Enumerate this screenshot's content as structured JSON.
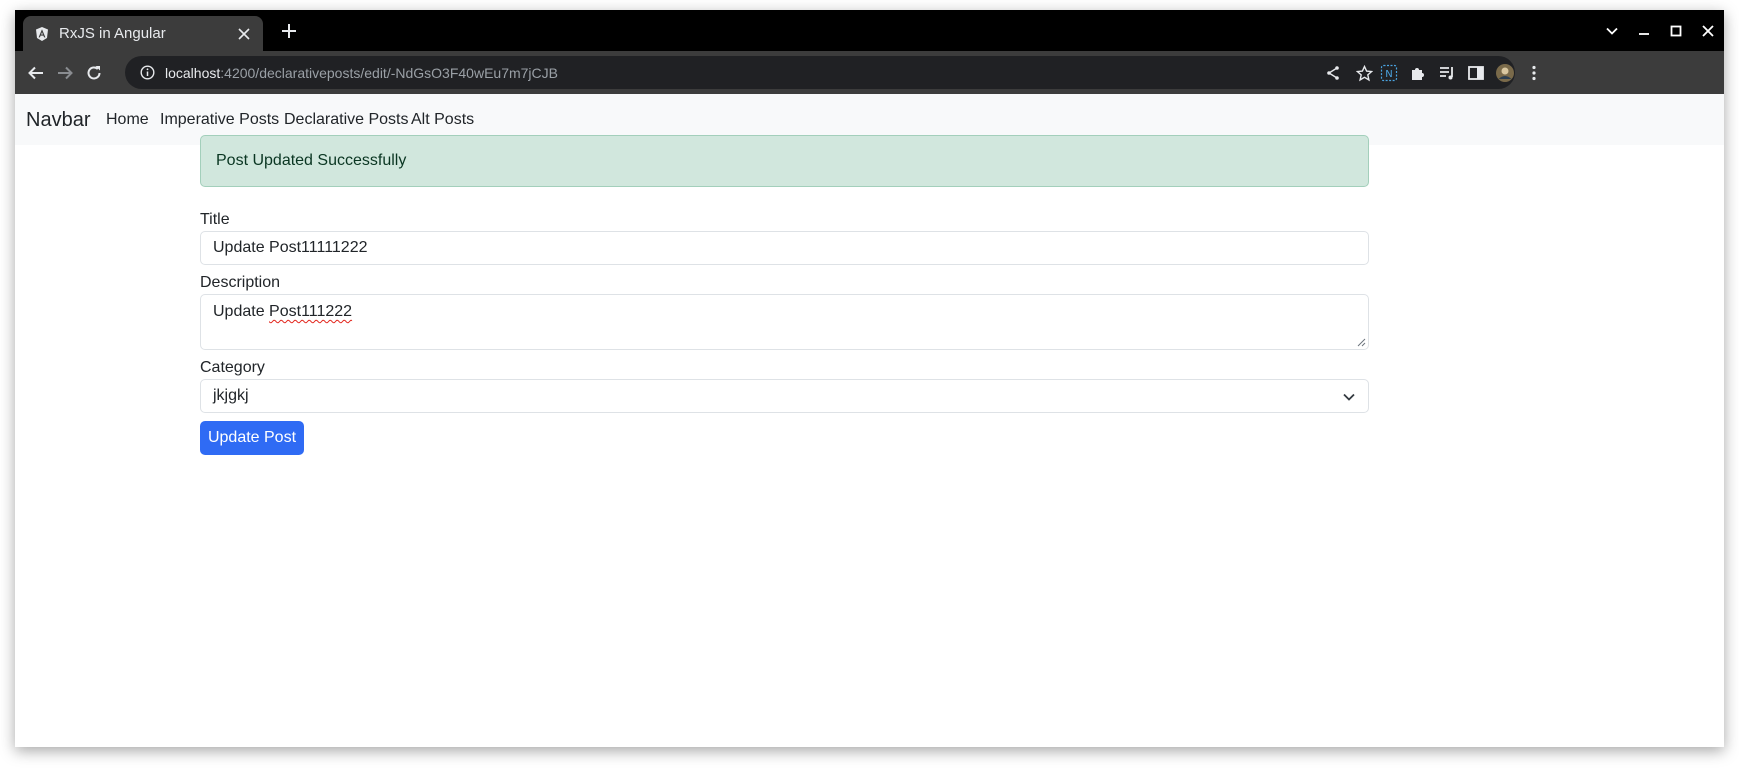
{
  "browser": {
    "tab": {
      "title": "RxJS in Angular",
      "favicon": "angular-icon"
    },
    "new_tab_label": "+",
    "url_host": "localhost",
    "url_rest": ":4200/declarativeposts/edit/-NdGsO3F40wEu7m7jCJB"
  },
  "navbar": {
    "brand": "Navbar",
    "links": [
      "Home",
      "Imperative Posts",
      "Declarative Posts",
      "Alt Posts"
    ]
  },
  "alert": {
    "message": "Post Updated Successfully",
    "color": "#d1e7dd"
  },
  "form": {
    "title_label": "Title",
    "title_value": "Update Post11111222",
    "description_label": "Description",
    "description_value_plain": "Update ",
    "description_value_misspelled": "Post111222",
    "category_label": "Category",
    "category_value": "jkjgkj",
    "submit_label": "Update Post",
    "submit_color": "#2f6bf4"
  }
}
